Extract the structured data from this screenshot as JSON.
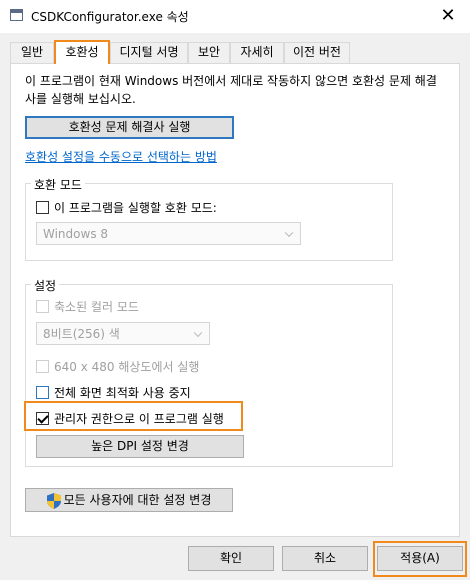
{
  "window": {
    "title": "CSDKConfigurator.exe 속성",
    "close_symbol": "✕"
  },
  "tabs": [
    {
      "label": "일반"
    },
    {
      "label": "호환성"
    },
    {
      "label": "디지털 서명"
    },
    {
      "label": "보안"
    },
    {
      "label": "자세히"
    },
    {
      "label": "이전 버전"
    }
  ],
  "active_tab": "호환성",
  "compat": {
    "description": "이 프로그램이 현재 Windows 버전에서 제대로 작동하지 않으면 호환성 문제 해결사를 실행해 보십시오.",
    "troubleshooter_button": "호환성 문제 해결사 실행",
    "manual_link": "호환성 설정을 수동으로 선택하는 방법"
  },
  "compat_mode": {
    "group_title": "호환 모드",
    "checkbox_label": "이 프로그램을 실행할 호환 모드:",
    "checked": false,
    "os_select_value": "Windows 8"
  },
  "settings": {
    "group_title": "설정",
    "reduced_color": {
      "label": "축소된 컬러 모드",
      "checked": false,
      "enabled": false
    },
    "color_select_value": "8비트(256) 색",
    "resolution_640": {
      "label": "640 x 480 해상도에서 실행",
      "checked": false,
      "enabled": false
    },
    "disable_fullscreen_opt": {
      "label": "전체 화면 최적화 사용 중지",
      "checked": false,
      "enabled": true
    },
    "run_as_admin": {
      "label": "관리자 권한으로 이 프로그램 실행",
      "checked": true,
      "enabled": true
    },
    "high_dpi_button": "높은 DPI 설정 변경"
  },
  "all_users_button": "모든 사용자에 대한 설정 변경",
  "footer": {
    "ok": "확인",
    "cancel": "취소",
    "apply": "적용(A)"
  },
  "colors": {
    "highlight": "#f08a1c",
    "link": "#0066cc",
    "focus": "#2e78bf"
  }
}
